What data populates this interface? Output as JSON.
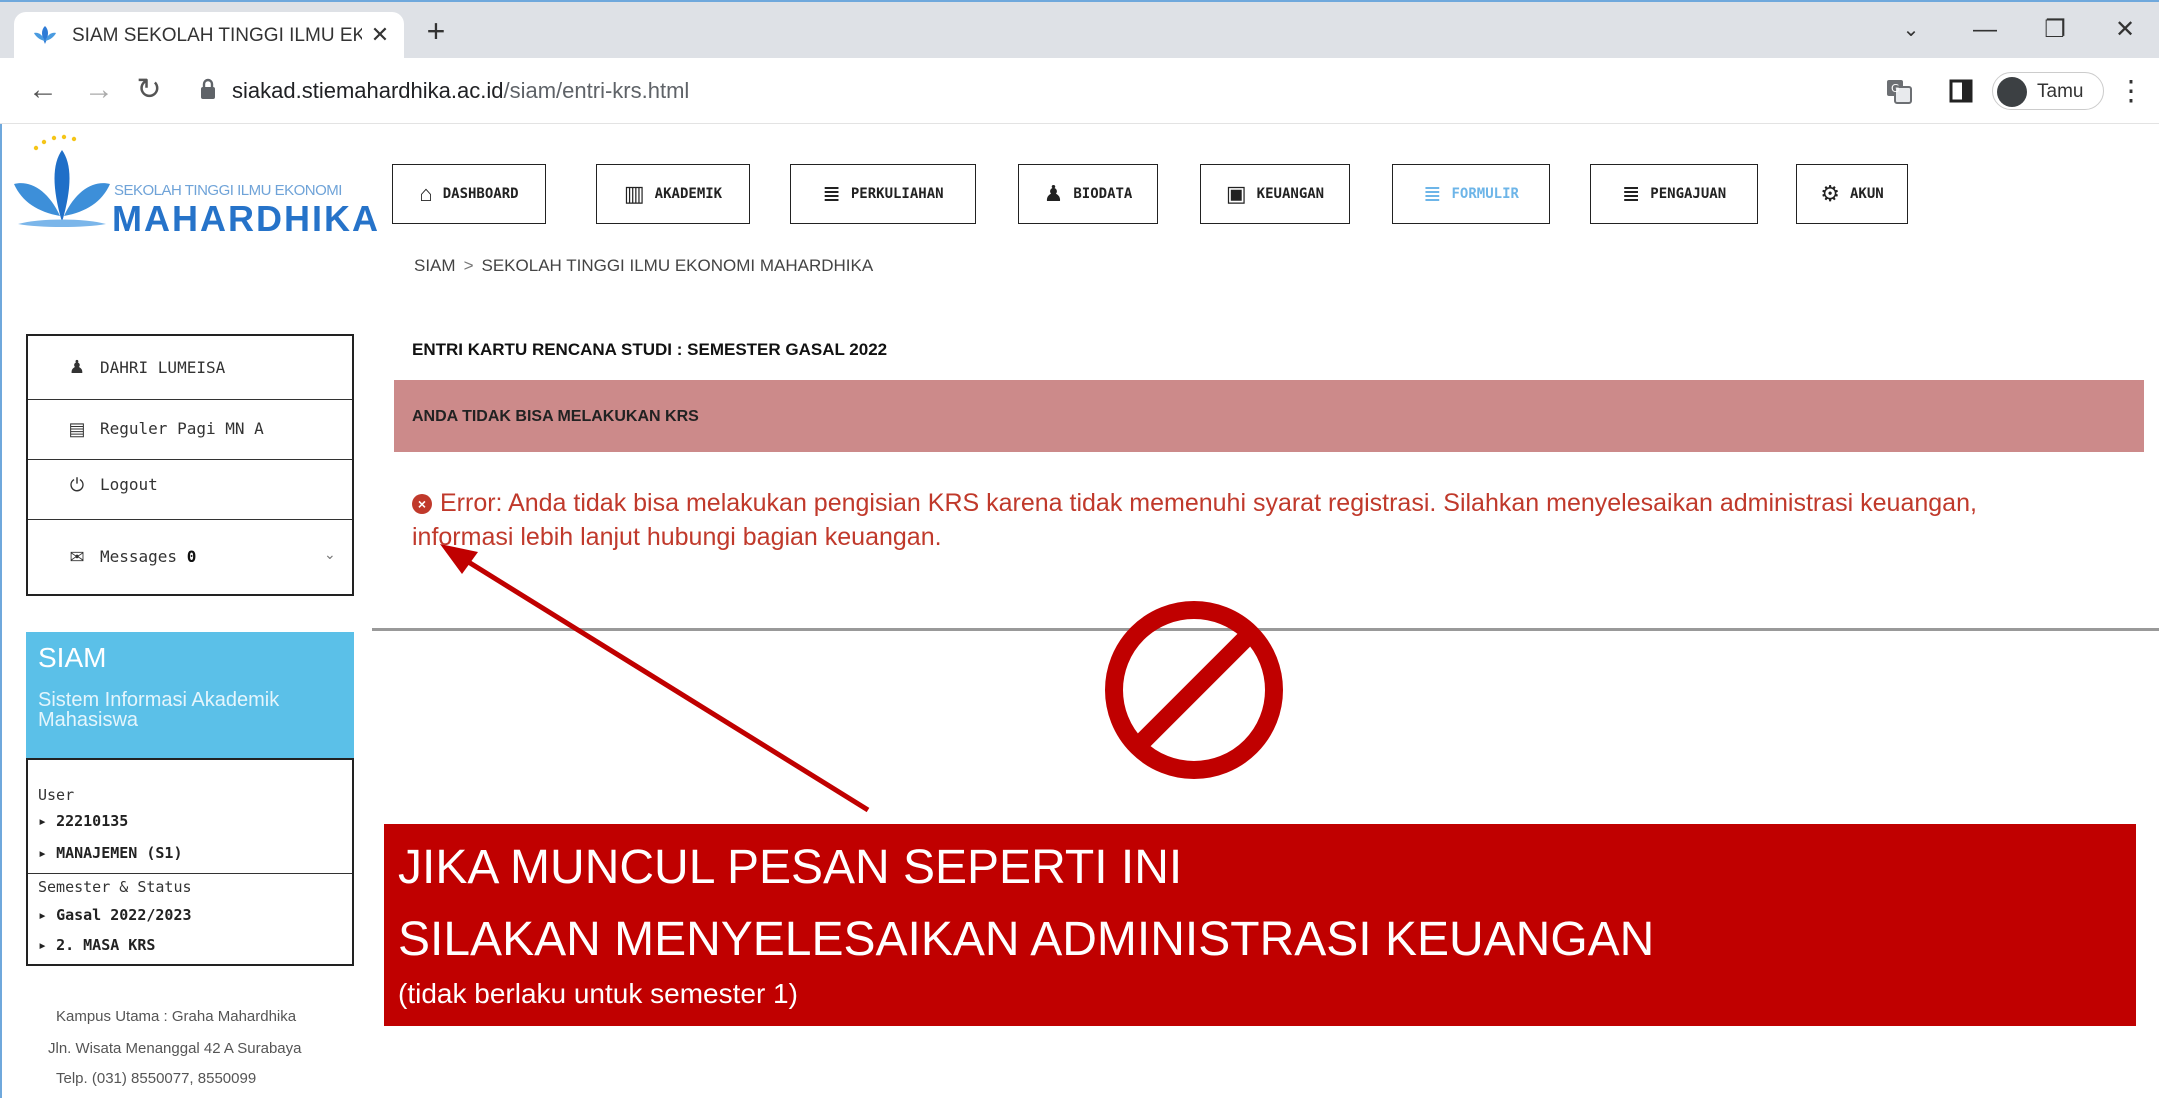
{
  "browser": {
    "tab_title": "SIAM SEKOLAH TINGGI ILMU EKONOMI MAHARDHIKA",
    "close_glyph": "✕",
    "newtab_glyph": "+",
    "url_host": "siakad.stiemahardhika.ac.id",
    "url_path": "/siam/entri-krs.html",
    "profile_name": "Tamu",
    "back_glyph": "←",
    "forward_glyph": "→",
    "reload_glyph": "↻",
    "menu_glyph": "⋮",
    "minimize_glyph": "—",
    "restore_glyph": "❐",
    "window_close_glyph": "✕",
    "tablist_glyph": "⌄"
  },
  "logo": {
    "subtitle": "SEKOLAH TINGGI ILMU EKONOMI",
    "name": "MAHARDHIKA"
  },
  "nav": {
    "items": [
      {
        "label": "DASHBOARD",
        "icon": "home-icon",
        "glyph": "⌂"
      },
      {
        "label": "AKADEMIK",
        "icon": "briefcase-icon",
        "glyph": "▥"
      },
      {
        "label": "PERKULIAHAN",
        "icon": "stack-icon",
        "glyph": "≣"
      },
      {
        "label": "BIODATA",
        "icon": "user-icon",
        "glyph": "♟"
      },
      {
        "label": "KEUANGAN",
        "icon": "money-icon",
        "glyph": "▣"
      },
      {
        "label": "FORMULIR",
        "icon": "stack-icon",
        "glyph": "≣"
      },
      {
        "label": "PENGAJUAN",
        "icon": "stack-icon",
        "glyph": "≣"
      },
      {
        "label": "AKUN",
        "icon": "gears-icon",
        "glyph": "⚙"
      }
    ],
    "active": "FORMULIR"
  },
  "breadcrumb": {
    "root": "SIAM",
    "separator": ">",
    "current": "SEKOLAH TINGGI ILMU EKONOMI MAHARDHIKA"
  },
  "sidebar": {
    "user_name": "DAHRI LUMEISA",
    "class_name": "Reguler Pagi MN A",
    "logout": "Logout",
    "messages_label": "Messages",
    "messages_count": "0",
    "siam_title": "SIAM",
    "siam_subtitle": "Sistem Informasi Akademik Mahasiswa",
    "status": {
      "user_label": "User",
      "nim": "22210135",
      "prodi": "MANAJEMEN (S1)",
      "semester_label": "Semester & Status",
      "semester": "Gasal 2022/2023",
      "status": "2. MASA KRS"
    },
    "address": {
      "line1": "Kampus Utama : Graha Mahardhika",
      "line2": "Jln. Wisata Menanggal 42 A Surabaya",
      "line3": "Telp. (031) 8550077, 8550099"
    }
  },
  "main": {
    "section_title": "ENTRI KARTU RENCANA STUDI : SEMESTER GASAL 2022",
    "alert": "ANDA TIDAK BISA MELAKUKAN KRS",
    "error_message": "Error: Anda tidak bisa melakukan pengisian KRS karena tidak memenuhi syarat registrasi. Silahkan menyelesaikan administrasi keuangan, informasi lebih lanjut hubungi bagian keuangan."
  },
  "annotation": {
    "line1": "JIKA MUNCUL PESAN SEPERTI INI",
    "line2": "SILAKAN MENYELESAIKAN ADMINISTRASI KEUANGAN",
    "note": "(tidak berlaku untuk semester 1)"
  },
  "colors": {
    "alert_bg": "#cc8a8a",
    "error_text": "#c0392b",
    "callout_bg": "#c00000",
    "siam_box": "#5bc0e8",
    "active_nav": "#6db5e8",
    "brand_blue": "#2673c9"
  }
}
